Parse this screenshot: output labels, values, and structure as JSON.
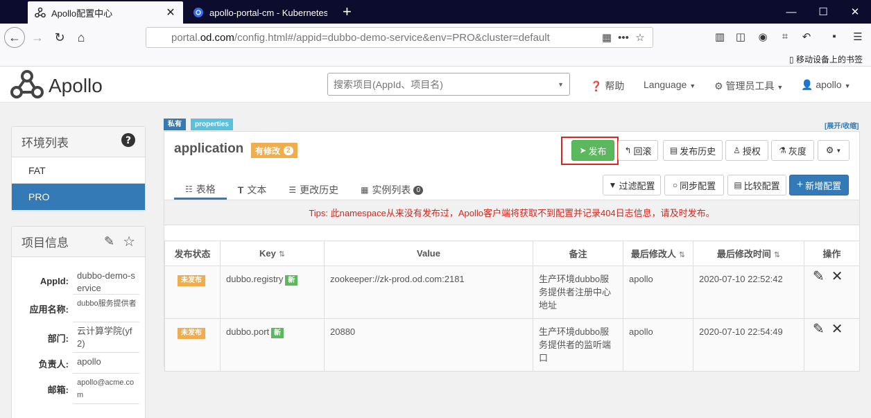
{
  "browser": {
    "tabs": [
      {
        "title": "Apollo配置中心",
        "close": "✕"
      },
      {
        "title": "apollo-portal-cm - Kubernetes"
      }
    ],
    "new_tab": "+",
    "window_controls": [
      "—",
      "☐",
      "✕"
    ],
    "url_host_prefix": "portal.",
    "url_host_main": "od.com",
    "url_rest": "/config.html#/appid=dubbo-demo-service&env=PRO&cluster=default",
    "url_more": "•••",
    "mobile_bookmarks": "移动设备上的书签"
  },
  "header": {
    "logo_text": "Apollo",
    "search_placeholder": "搜索项目(AppId、项目名)",
    "help": "帮助",
    "language": "Language",
    "admin_tools": "管理员工具",
    "user": "apollo"
  },
  "env_panel": {
    "title": "环境列表",
    "items": [
      {
        "label": "FAT",
        "active": false
      },
      {
        "label": "PRO",
        "active": true
      }
    ]
  },
  "project_panel": {
    "title": "项目信息",
    "rows": [
      {
        "label": "AppId:",
        "value": "dubbo-demo-service"
      },
      {
        "label": "应用名称:",
        "value": "dubbo服务提供者"
      },
      {
        "label": "部门:",
        "value": "云计算学院(yf2)"
      },
      {
        "label": "负责人:",
        "value": "apollo"
      },
      {
        "label": "邮箱:",
        "value": "apollo@acme.com"
      }
    ]
  },
  "namespace": {
    "tag_private": "私有",
    "tag_format": "properties",
    "expand_link": "[展开/收缩]",
    "name": "application",
    "modified_label": "有修改",
    "modified_count": "2",
    "buttons": {
      "publish": "发布",
      "rollback": "回滚",
      "history": "发布历史",
      "authorize": "授权",
      "gray": "灰度"
    },
    "tabs": [
      {
        "label": "表格",
        "active": true
      },
      {
        "label": "文本",
        "active": false
      },
      {
        "label": "更改历史",
        "active": false
      },
      {
        "label": "实例列表",
        "active": false,
        "count": "0"
      }
    ],
    "actions": {
      "filter": "过滤配置",
      "sync": "同步配置",
      "compare": "比较配置",
      "add": "新增配置"
    },
    "tips": "Tips: 此namespace从来没有发布过，Apollo客户端将获取不到配置并记录404日志信息，请及时发布。",
    "table": {
      "headers": {
        "status": "发布状态",
        "key": "Key",
        "value": "Value",
        "comment": "备注",
        "modifier": "最后修改人",
        "modified_time": "最后修改时间",
        "ops": "操作"
      },
      "rows": [
        {
          "status": "未发布",
          "key": "dubbo.registry",
          "new_tag": "新",
          "value": "zookeeper://zk-prod.od.com:2181",
          "comment": "生产环境dubbo服务提供者注册中心地址",
          "modifier": "apollo",
          "time": "2020-07-10 22:52:42"
        },
        {
          "status": "未发布",
          "key": "dubbo.port",
          "new_tag": "新",
          "value": "20880",
          "comment": "生产环境dubbo服务提供者的监听端口",
          "modifier": "apollo",
          "time": "2020-07-10 22:54:49"
        }
      ]
    }
  },
  "colors": {
    "primary": "#337ab7",
    "success": "#5cb85c",
    "warning": "#f0ad4e",
    "danger": "#d9251d"
  }
}
